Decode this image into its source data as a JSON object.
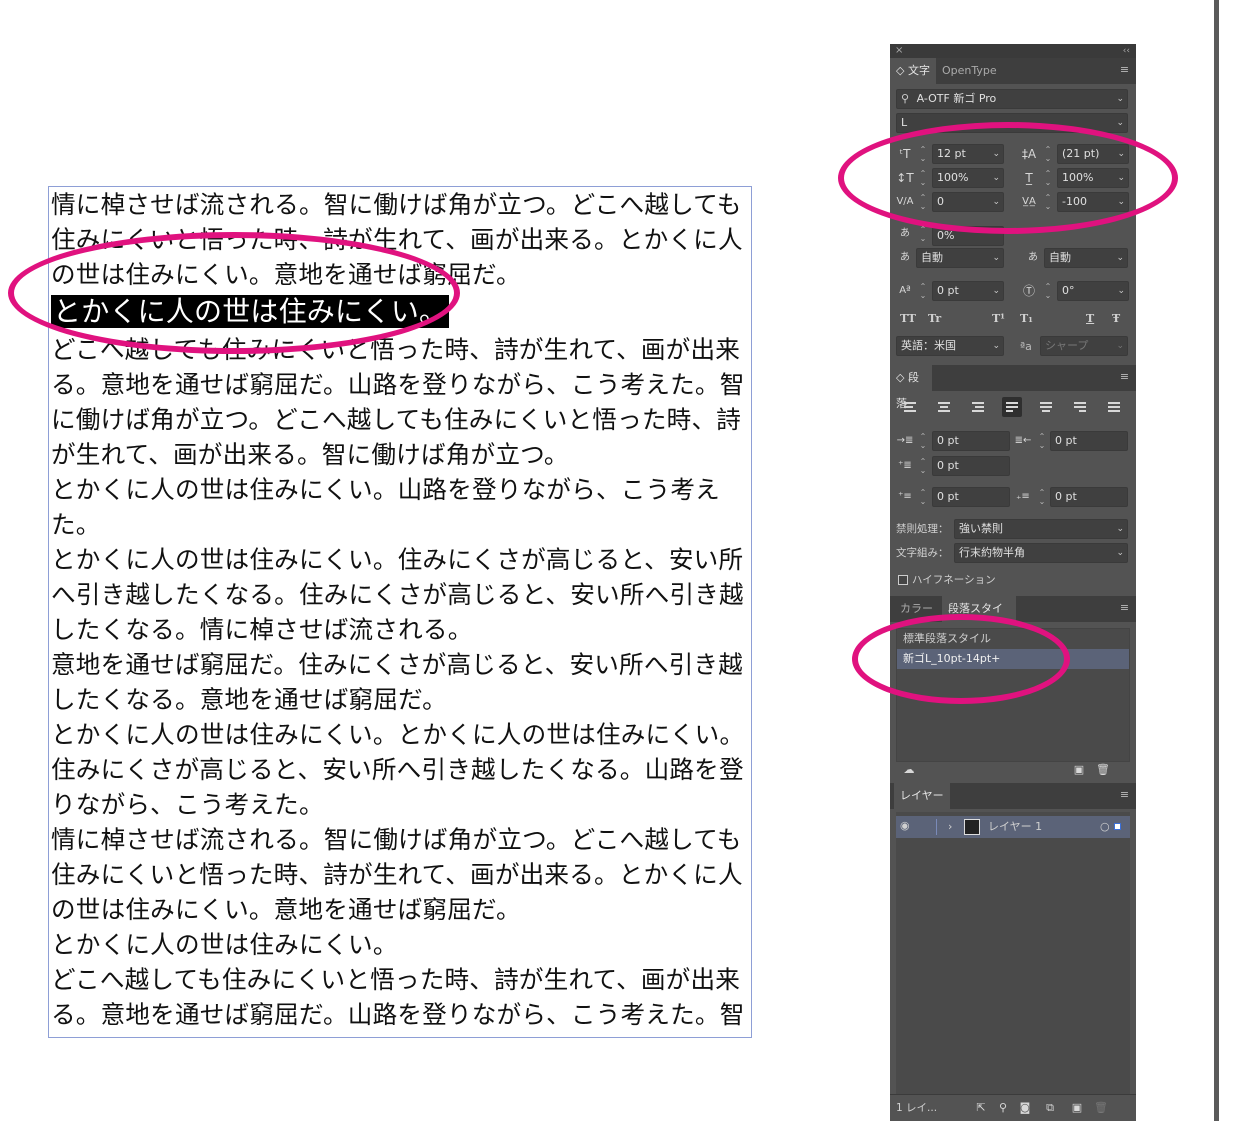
{
  "canvas": {
    "paragraphs": [
      "情に棹させば流される。智に働けば角が立つ。どこへ越しても住みにくいと悟った時、詩が生れて、画が出来る。とかくに人の世は住みにくい。意地を通せば窮屈だ。",
      "とかくに人の世は住みにくい。",
      "どこへ越しても住みにくいと悟った時、詩が生れて、画が出来る。意地を通せば窮屈だ。山路を登りながら、こう考えた。智に働けば角が立つ。どこへ越しても住みにくいと悟った時、詩が生れて、画が出来る。智に働けば角が立つ。",
      "とかくに人の世は住みにくい。山路を登りながら、こう考えた。",
      "とかくに人の世は住みにくい。住みにくさが高じると、安い所へ引き越したくなる。住みにくさが高じると、安い所へ引き越したくなる。情に棹させば流される。",
      "意地を通せば窮屈だ。住みにくさが高じると、安い所へ引き越したくなる。意地を通せば窮屈だ。",
      "とかくに人の世は住みにくい。とかくに人の世は住みにくい。住みにくさが高じると、安い所へ引き越したくなる。山路を登りながら、こう考えた。",
      "情に棹させば流される。智に働けば角が立つ。どこへ越しても住みにくいと悟った時、詩が生れて、画が出来る。とかくに人の世は住みにくい。意地を通せば窮屈だ。",
      "とかくに人の世は住みにくい。",
      "どこへ越しても住みにくいと悟った時、詩が生れて、画が出来る。意地を通せば窮屈だ。山路を登りながら、こう考えた。智に働けば角が立つ。どこへ越しても住みにくいと悟った時、詩"
    ]
  },
  "panel": {
    "close_glyph": "×",
    "collapse_glyph": "‹‹",
    "menu_glyph": "≡",
    "character": {
      "tabs": [
        "◇ 文字",
        "OpenType"
      ],
      "font_family": "A-OTF 新ゴ Pro",
      "font_style": "L",
      "font_size": "12 pt",
      "leading": "(21 pt)",
      "vertical_scale": "100%",
      "horizontal_scale": "100%",
      "kerning": "0",
      "tracking": "-100",
      "tsume": "0%",
      "aki_left": "自動",
      "aki_right": "自動",
      "baseline_shift": "0 pt",
      "rotation": "0°",
      "case_buttons": [
        "TT",
        "Tr",
        "T¹",
        "T₁",
        "T",
        "Ŧ"
      ],
      "language": "英語：米国",
      "antialias_icon": "ªa",
      "antialias": "シャープ"
    },
    "paragraph": {
      "tab": "◇ 段落",
      "left_indent": "0 pt",
      "right_indent": "0 pt",
      "first_line_indent": "0 pt",
      "space_before": "0 pt",
      "space_after": "0 pt",
      "kinsoku_label": "禁則処理：",
      "kinsoku_value": "強い禁則",
      "mojikumi_label": "文字組み：",
      "mojikumi_value": "行末約物半角",
      "hyphenation_label": "ハイフネーション"
    },
    "styles": {
      "tabs": [
        "カラー",
        "段落スタイル"
      ],
      "items": [
        "標準段落スタイル",
        "新ゴL_10pt-14pt+"
      ]
    },
    "layers": {
      "tab": "レイヤー",
      "eye_glyph": "◉",
      "expand_glyph": "›",
      "layer_name": "レイヤー 1",
      "target_glyph": "○",
      "footer_count": "1 レイ..."
    }
  }
}
